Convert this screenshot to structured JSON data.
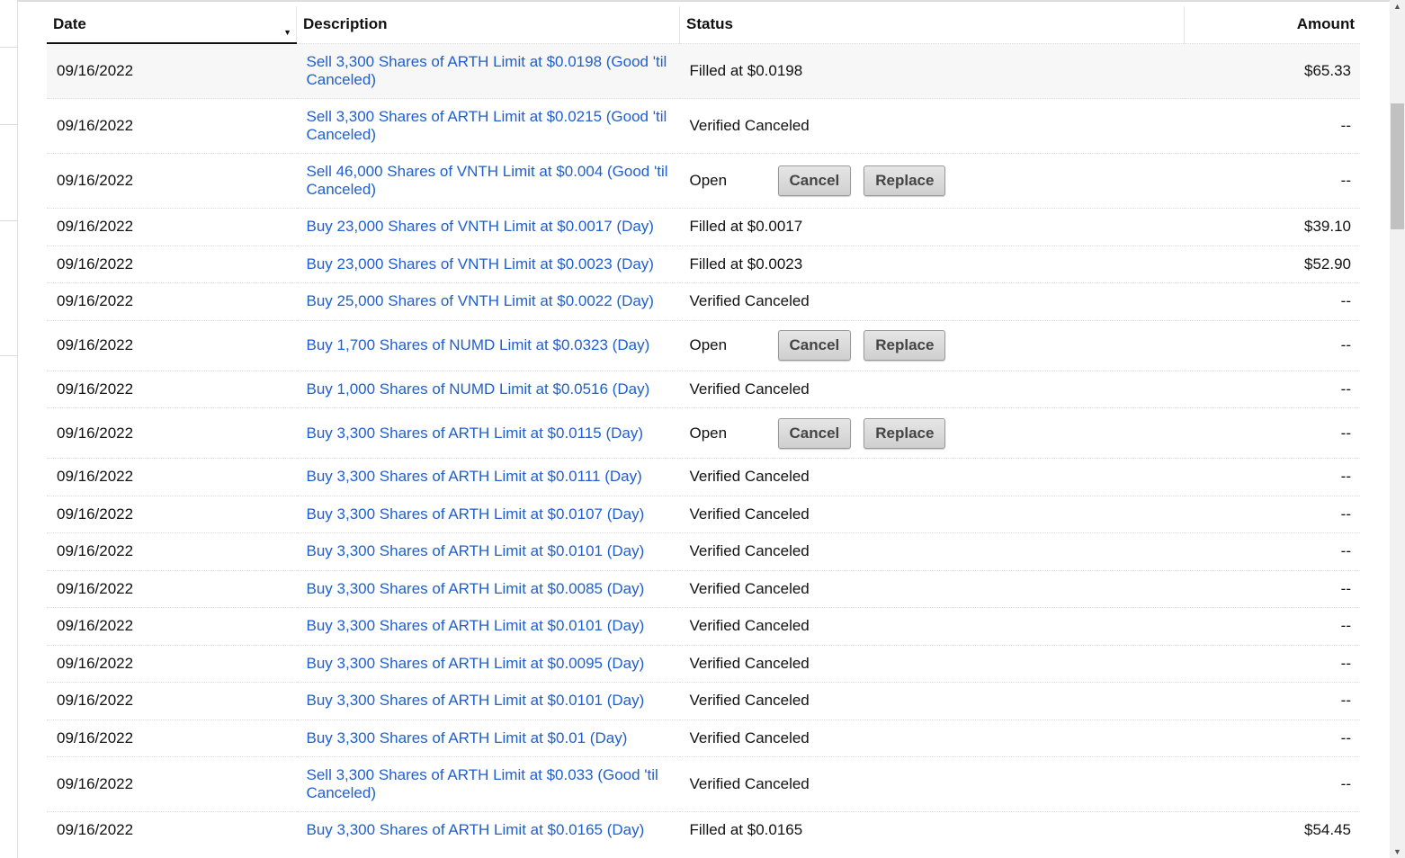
{
  "columns": {
    "date": "Date",
    "description": "Description",
    "status": "Status",
    "amount": "Amount"
  },
  "buttons": {
    "cancel": "Cancel",
    "replace": "Replace"
  },
  "rows": [
    {
      "date": "09/16/2022",
      "description": "Sell 3,300 Shares of ARTH Limit at $0.0198 (Good 'til Canceled)",
      "status": "Filled at $0.0198",
      "amount": "$65.33",
      "type": "r2"
    },
    {
      "date": "09/16/2022",
      "description": "Sell 3,300 Shares of ARTH Limit at $0.0215 (Good 'til Canceled)",
      "status": "Verified Canceled",
      "amount": "--",
      "type": "r2"
    },
    {
      "date": "09/16/2022",
      "description": "Sell 46,000 Shares of VNTH Limit at $0.004 (Good 'til Canceled)",
      "status": "Open",
      "amount": "--",
      "type": "r2",
      "open": true
    },
    {
      "date": "09/16/2022",
      "description": "Buy 23,000 Shares of VNTH Limit at $0.0017 (Day)",
      "status": "Filled at $0.0017",
      "amount": "$39.10",
      "type": "r1"
    },
    {
      "date": "09/16/2022",
      "description": "Buy 23,000 Shares of VNTH Limit at $0.0023 (Day)",
      "status": "Filled at $0.0023",
      "amount": "$52.90",
      "type": "r1"
    },
    {
      "date": "09/16/2022",
      "description": "Buy 25,000 Shares of VNTH Limit at $0.0022 (Day)",
      "status": "Verified Canceled",
      "amount": "--",
      "type": "r1"
    },
    {
      "date": "09/16/2022",
      "description": "Buy 1,700 Shares of NUMD Limit at $0.0323 (Day)",
      "status": "Open",
      "amount": "--",
      "type": "rb",
      "open": true
    },
    {
      "date": "09/16/2022",
      "description": "Buy 1,000 Shares of NUMD Limit at $0.0516 (Day)",
      "status": "Verified Canceled",
      "amount": "--",
      "type": "r1"
    },
    {
      "date": "09/16/2022",
      "description": "Buy 3,300 Shares of ARTH Limit at $0.0115 (Day)",
      "status": "Open",
      "amount": "--",
      "type": "rb",
      "open": true
    },
    {
      "date": "09/16/2022",
      "description": "Buy 3,300 Shares of ARTH Limit at $0.0111 (Day)",
      "status": "Verified Canceled",
      "amount": "--",
      "type": "r1"
    },
    {
      "date": "09/16/2022",
      "description": "Buy 3,300 Shares of ARTH Limit at $0.0107 (Day)",
      "status": "Verified Canceled",
      "amount": "--",
      "type": "r1"
    },
    {
      "date": "09/16/2022",
      "description": "Buy 3,300 Shares of ARTH Limit at $0.0101 (Day)",
      "status": "Verified Canceled",
      "amount": "--",
      "type": "r1"
    },
    {
      "date": "09/16/2022",
      "description": "Buy 3,300 Shares of ARTH Limit at $0.0085 (Day)",
      "status": "Verified Canceled",
      "amount": "--",
      "type": "r1"
    },
    {
      "date": "09/16/2022",
      "description": "Buy 3,300 Shares of ARTH Limit at $0.0101 (Day)",
      "status": "Verified Canceled",
      "amount": "--",
      "type": "r1"
    },
    {
      "date": "09/16/2022",
      "description": "Buy 3,300 Shares of ARTH Limit at $0.0095 (Day)",
      "status": "Verified Canceled",
      "amount": "--",
      "type": "r1"
    },
    {
      "date": "09/16/2022",
      "description": "Buy 3,300 Shares of ARTH Limit at $0.0101 (Day)",
      "status": "Verified Canceled",
      "amount": "--",
      "type": "r1"
    },
    {
      "date": "09/16/2022",
      "description": "Buy 3,300 Shares of ARTH Limit at $0.01 (Day)",
      "status": "Verified Canceled",
      "amount": "--",
      "type": "r1"
    },
    {
      "date": "09/16/2022",
      "description": "Sell 3,300 Shares of ARTH Limit at $0.033 (Good 'til Canceled)",
      "status": "Verified Canceled",
      "amount": "--",
      "type": "r2"
    },
    {
      "date": "09/16/2022",
      "description": "Buy 3,300 Shares of ARTH Limit at $0.0165 (Day)",
      "status": "Filled at $0.0165",
      "amount": "$54.45",
      "type": "r1"
    }
  ]
}
